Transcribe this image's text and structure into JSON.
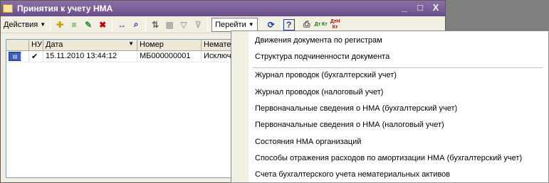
{
  "window": {
    "title": "Принятия к учету НМА",
    "icon": "document-folder-icon",
    "controls": [
      "_",
      "□",
      "X"
    ]
  },
  "toolbar": {
    "actions_label": "Действия",
    "goto_label": "Перейти",
    "help_label": "?",
    "dt_kt": "Дт Кт",
    "dt_kt_n": "ДтН Кт"
  },
  "table": {
    "headers": [
      "",
      "НУ",
      "Дата",
      "Номер",
      "Нематери"
    ],
    "rows": [
      {
        "check": "✔",
        "date": "15.11.2010 13:44:12",
        "number": "МБ000000001",
        "type": "Исключит"
      }
    ]
  },
  "menu": {
    "items": [
      "Движения документа по регистрам",
      "Структура подчиненности документа",
      "Журнал проводок (бухгалтерский учет)",
      "Журнал проводок (налоговый учет)",
      "Первоначальные сведения о НМА (бухгалтерский учет)",
      "Первоначальные сведения о НМА (налоговый учет)",
      "Состояния НМА организаций",
      "Способы отражения расходов по амортизации НМА (бухгалтерский учет)",
      "Счета бухгалтерского учета нематериальных активов"
    ]
  }
}
